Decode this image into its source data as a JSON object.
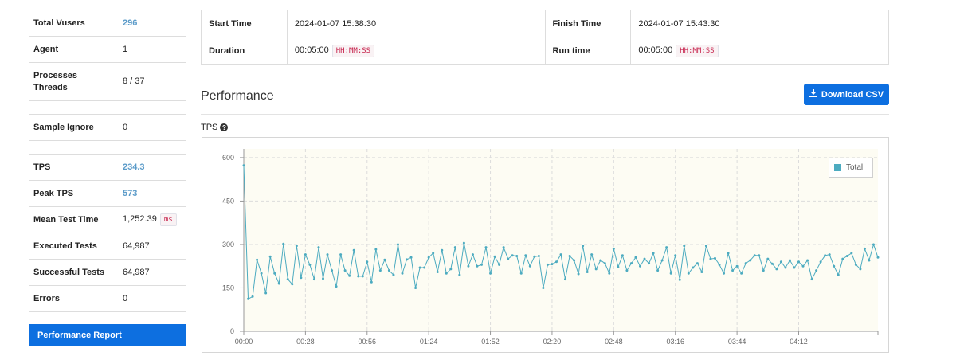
{
  "stats": {
    "total_vusers": {
      "label": "Total Vusers",
      "value": "296"
    },
    "agent": {
      "label": "Agent",
      "value": "1"
    },
    "processes_threads": {
      "label": "Processes Threads",
      "value": "8 / 37"
    },
    "sample_ignore": {
      "label": "Sample Ignore",
      "value": "0"
    },
    "tps": {
      "label": "TPS",
      "value": "234.3"
    },
    "peak_tps": {
      "label": "Peak TPS",
      "value": "573"
    },
    "mean_test_time": {
      "label": "Mean Test Time",
      "value": "1,252.39",
      "unit": "ms"
    },
    "executed_tests": {
      "label": "Executed Tests",
      "value": "64,987"
    },
    "successful_tests": {
      "label": "Successful Tests",
      "value": "64,987"
    },
    "errors": {
      "label": "Errors",
      "value": "0"
    }
  },
  "report_button": "Performance Report",
  "info": {
    "start_time_label": "Start Time",
    "start_time": "2024-01-07 15:38:30",
    "finish_time_label": "Finish Time",
    "finish_time": "2024-01-07 15:43:30",
    "duration_label": "Duration",
    "duration": "00:05:00",
    "duration_format": "HH:MM:SS",
    "run_time_label": "Run time",
    "run_time": "00:05:00",
    "run_time_format": "HH:MM:SS"
  },
  "performance_title": "Performance",
  "download_csv": "Download CSV",
  "tps_label": "TPS",
  "chart_data": {
    "type": "line",
    "title": "",
    "xlabel": "",
    "ylabel": "",
    "ylim": [
      0,
      630
    ],
    "yticks": [
      0,
      150,
      300,
      450,
      600
    ],
    "xticks": [
      "00:00",
      "00:28",
      "00:56",
      "01:24",
      "01:52",
      "02:20",
      "02:48",
      "03:16",
      "03:44",
      "04:12"
    ],
    "x_interval_seconds": 2,
    "grid": true,
    "legend_position": "top-right",
    "line_color": "#4cabc0",
    "plot_background": "#fdfcf3",
    "series": [
      {
        "name": "Total",
        "values": [
          573,
          112,
          120,
          247,
          200,
          132,
          258,
          200,
          165,
          302,
          180,
          163,
          295,
          185,
          265,
          230,
          180,
          290,
          182,
          265,
          210,
          155,
          265,
          210,
          192,
          280,
          190,
          190,
          240,
          170,
          283,
          210,
          247,
          210,
          195,
          300,
          200,
          248,
          255,
          150,
          220,
          220,
          255,
          270,
          205,
          280,
          200,
          215,
          290,
          195,
          305,
          225,
          265,
          225,
          230,
          290,
          200,
          258,
          230,
          290,
          250,
          262,
          260,
          200,
          262,
          225,
          258,
          260,
          150,
          230,
          232,
          240,
          265,
          180,
          260,
          245,
          198,
          295,
          205,
          265,
          215,
          245,
          235,
          200,
          285,
          222,
          262,
          210,
          235,
          255,
          225,
          250,
          235,
          270,
          210,
          245,
          290,
          200,
          262,
          178,
          295,
          200,
          220,
          235,
          205,
          295,
          250,
          252,
          230,
          200,
          270,
          210,
          225,
          200,
          235,
          245,
          262,
          262,
          210,
          250,
          233,
          215,
          240,
          220,
          245,
          220,
          240,
          225,
          245,
          180,
          210,
          240,
          262,
          265,
          225,
          195,
          250,
          260,
          270,
          230,
          215,
          285,
          245,
          300,
          255
        ]
      }
    ]
  }
}
